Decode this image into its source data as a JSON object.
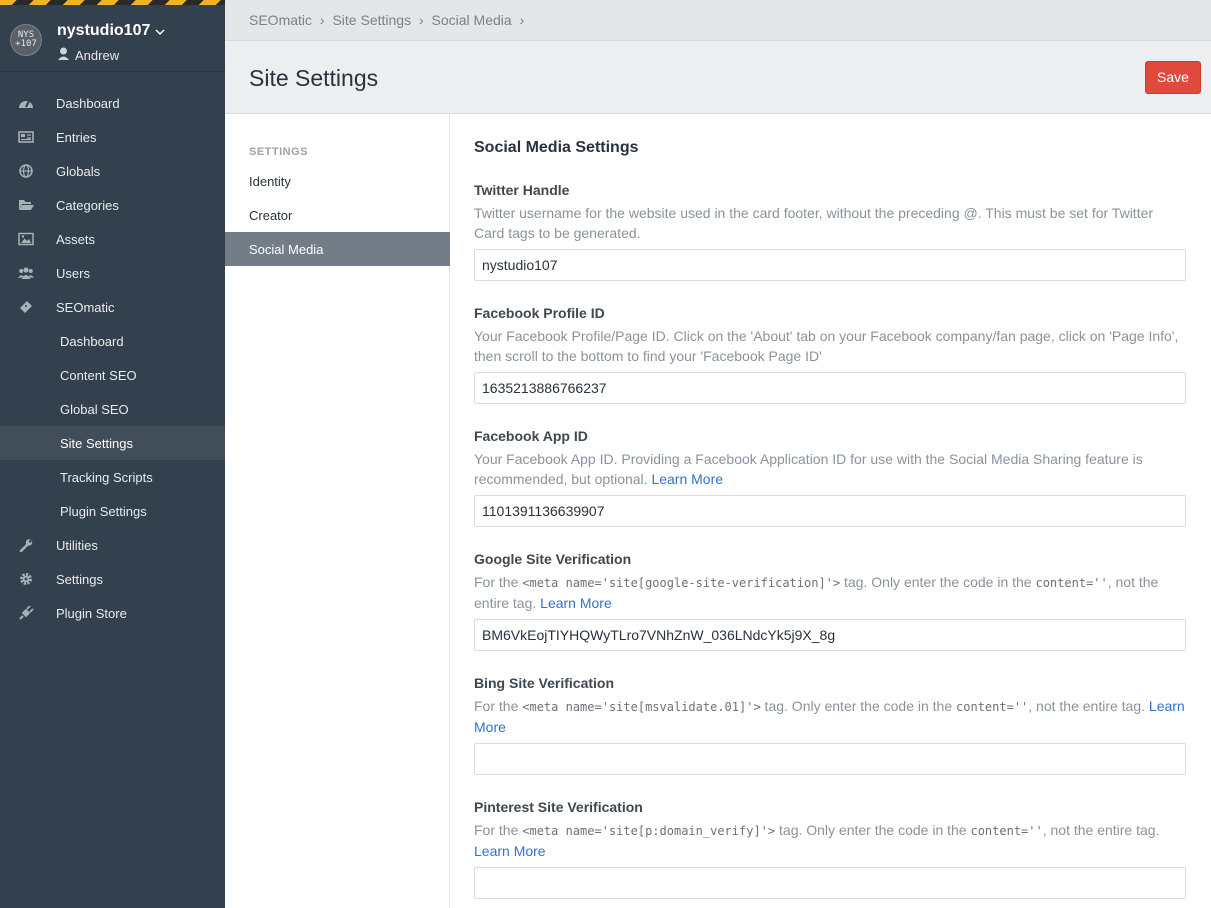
{
  "site": {
    "name": "nystudio107",
    "logo_text": "NYS\n+107",
    "user": "Andrew"
  },
  "nav": {
    "items": [
      {
        "label": "Dashboard"
      },
      {
        "label": "Entries"
      },
      {
        "label": "Globals"
      },
      {
        "label": "Categories"
      },
      {
        "label": "Assets"
      },
      {
        "label": "Users"
      },
      {
        "label": "SEOmatic"
      }
    ],
    "sub_items": [
      {
        "label": "Dashboard"
      },
      {
        "label": "Content SEO"
      },
      {
        "label": "Global SEO"
      },
      {
        "label": "Site Settings"
      },
      {
        "label": "Tracking Scripts"
      },
      {
        "label": "Plugin Settings"
      }
    ],
    "bottom_items": [
      {
        "label": "Utilities"
      },
      {
        "label": "Settings"
      },
      {
        "label": "Plugin Store"
      }
    ]
  },
  "breadcrumb": [
    "SEOmatic",
    "›",
    "Site Settings",
    "›",
    "Social Media",
    "›"
  ],
  "page": {
    "title": "Site Settings",
    "save_label": "Save"
  },
  "subnav": {
    "heading": "SETTINGS",
    "items": [
      {
        "label": "Identity"
      },
      {
        "label": "Creator"
      },
      {
        "label": "Social Media"
      }
    ]
  },
  "content": {
    "title": "Social Media Settings",
    "fields": [
      {
        "label": "Twitter Handle",
        "desc": "Twitter username for the website used in the card footer, without the preceding @. This must be set for Twitter Card tags to be generated.",
        "value": "nystudio107"
      },
      {
        "label": "Facebook Profile ID",
        "desc": "Your Facebook Profile/Page ID. Click on the 'About' tab on your Facebook company/fan page, click on 'Page Info', then scroll to the bottom to find your 'Facebook Page ID'",
        "value": "1635213886766237"
      },
      {
        "label": "Facebook App ID",
        "desc": "Your Facebook App ID. Providing a Facebook Application ID for use with the Social Media Sharing feature is recommended, but optional.",
        "link": "Learn More",
        "value": "1101391136639907"
      },
      {
        "label": "Google Site Verification",
        "desc_pre": "For the ",
        "code1": "<meta name='site[google-site-verification]'>",
        "desc_mid": " tag. Only enter the code in the ",
        "code2": "content=''",
        "desc_post": ", not the entire tag.",
        "link": "Learn More",
        "value": "BM6VkEojTIYHQWyTLro7VNhZnW_036LNdcYk5j9X_8g"
      },
      {
        "label": "Bing Site Verification",
        "desc_pre": "For the ",
        "code1": "<meta name='site[msvalidate.01]'>",
        "desc_mid": " tag. Only enter the code in the ",
        "code2": "content=''",
        "desc_post": ", not the entire tag.",
        "link": "Learn More",
        "value": ""
      },
      {
        "label": "Pinterest Site Verification",
        "desc_pre": "For the ",
        "code1": "<meta name='site[p:domain_verify]'>",
        "desc_mid": " tag. Only enter the code in the ",
        "code2": "content=''",
        "desc_post": ", not the entire tag.",
        "link": "Learn More",
        "value": ""
      }
    ]
  }
}
